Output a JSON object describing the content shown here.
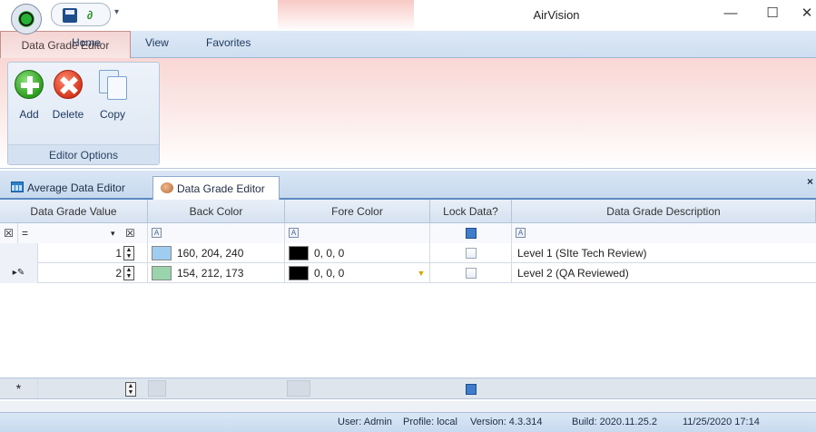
{
  "window": {
    "title": "AirVision",
    "minimize_label": "—",
    "maximize_label": "☐",
    "close_label": "✕"
  },
  "quick_access": {
    "help_glyph": "∂",
    "dropdown_glyph": "▾"
  },
  "ribbon": {
    "tabs": [
      "Home",
      "View",
      "Favorites",
      "Data Grade Editor"
    ],
    "active_tab": "Data Grade Editor",
    "group": {
      "caption": "Editor Options",
      "buttons": [
        {
          "label": "Add",
          "icon": "add-icon"
        },
        {
          "label": "Delete",
          "icon": "delete-icon"
        },
        {
          "label": "Copy",
          "icon": "copy-icon"
        }
      ]
    }
  },
  "document_tabs": [
    {
      "label": "Average Data Editor",
      "icon": "grid-icon"
    },
    {
      "label": "Data Grade Editor",
      "icon": "people-icon",
      "active": true
    }
  ],
  "panel_close_label": "×",
  "grid": {
    "columns": [
      "Data Grade Value",
      "Back Color",
      "Fore Color",
      "Lock Data?",
      "Data Grade Description"
    ],
    "filter_row": {
      "operator": "=",
      "indicator_glyph": "☒",
      "dropdown_glyph": "▾",
      "filter_glyph": "A"
    },
    "rows": [
      {
        "value": "1",
        "back_color": "160, 204, 240",
        "back_hex": "#a0ccf0",
        "fore_color": "0, 0, 0",
        "fore_hex": "#000000",
        "lock": false,
        "description": "Level 1 (SIte Tech Review)",
        "indicator": ""
      },
      {
        "value": "2",
        "back_color": "154, 212, 173",
        "back_hex": "#9ad4ad",
        "fore_color": "0, 0, 0",
        "fore_hex": "#000000",
        "lock": false,
        "description": "Level 2 (QA Reviewed)",
        "indicator": "▸✎"
      }
    ],
    "new_row_indicator": "*"
  },
  "status": {
    "user": "User: Admin",
    "profile": "Profile: local",
    "version": "Version: 4.3.314",
    "build": "Build: 2020.11.25.2",
    "datetime": "11/25/2020  17:14"
  },
  "colors": {
    "accent_tab": "#f3d5d3",
    "ribbon_blue": "#dbe6f3",
    "status_bar": "#c8daef"
  }
}
